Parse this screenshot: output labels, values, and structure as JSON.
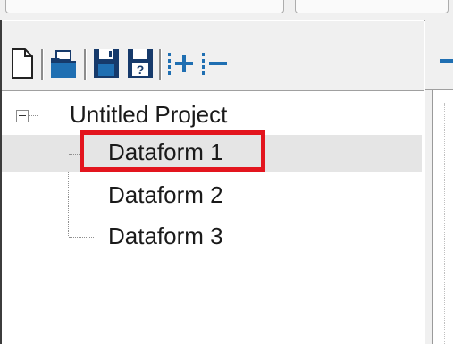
{
  "toolbar": {
    "icons": [
      "new-file-icon",
      "open-folder-icon",
      "save-icon",
      "save-as-icon",
      "add-icon",
      "remove-icon"
    ]
  },
  "tree": {
    "root": {
      "label": "Untitled Project",
      "expanded": true
    },
    "children": [
      {
        "label": "Dataform 1",
        "selected": true
      },
      {
        "label": "Dataform 2",
        "selected": false
      },
      {
        "label": "Dataform 3",
        "selected": false
      }
    ]
  },
  "colors": {
    "highlight": "#e3151e",
    "selection": "#e5e5e5",
    "icon_blue": "#1f6fb2",
    "icon_navy": "#163a6b"
  }
}
